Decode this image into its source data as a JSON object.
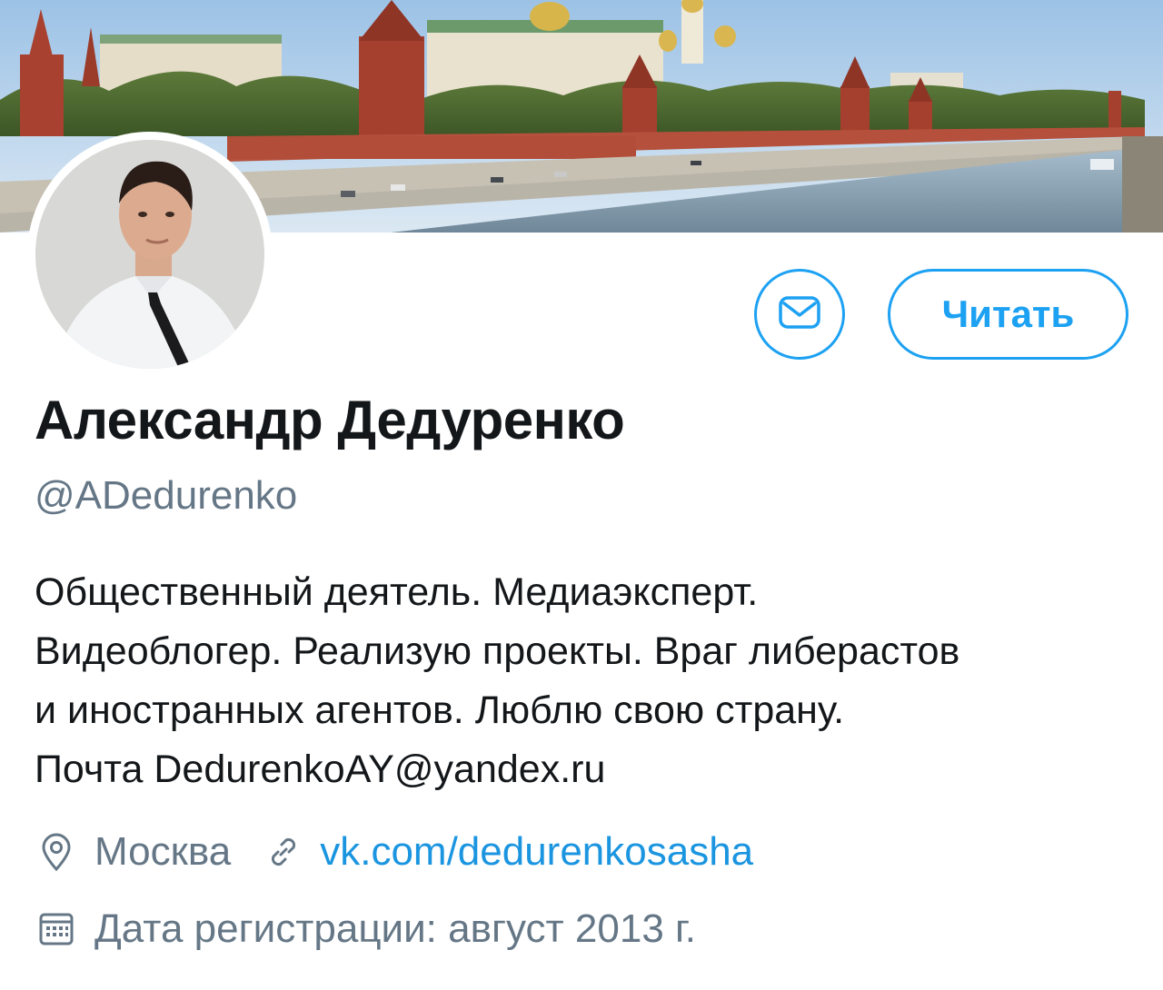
{
  "profile": {
    "name": "Александр Дедуренко",
    "handle": "@ADedurenko",
    "bio_lines": [
      "Общественный деятель. Медиаэксперт.",
      "Видеоблогер. Реализую проекты. Враг либерастов",
      "и иностранных агентов. Люблю свою страну.",
      "Почта DedurenkoAY@yandex.ru"
    ],
    "location": "Москва",
    "website": "vk.com/dedurenkosasha",
    "joined": "Дата регистрации: август 2013 г."
  },
  "actions": {
    "message_icon": "envelope-icon",
    "follow_label": "Читать"
  },
  "icons": {
    "location": "map-pin-icon",
    "website": "link-icon",
    "joined": "calendar-icon"
  },
  "colors": {
    "accent": "#1da1f2",
    "link": "#1b95e0",
    "text": "#14171a",
    "secondary": "#657786"
  }
}
